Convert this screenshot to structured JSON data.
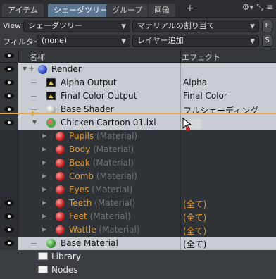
{
  "tabs": [
    {
      "label": "アイテム",
      "active": false
    },
    {
      "label": "シェーダツリー",
      "active": true
    },
    {
      "label": "グループ",
      "active": false
    },
    {
      "label": "画像",
      "active": false
    }
  ],
  "tab_add": "+",
  "top_icons": [
    "gear-icon",
    "expand-icon",
    "menu-icon"
  ],
  "view": {
    "label": "View",
    "dropdown": "シェーダツリー",
    "add_dropdown": "マテリアルの割り当て",
    "button": "F"
  },
  "filter": {
    "label": "フィルター:",
    "dropdown": "(none)",
    "add_dropdown": "レイヤー追加",
    "button": "S"
  },
  "columns": {
    "name": "名称",
    "effect": "エフェクト"
  },
  "tree": [
    {
      "label": "Render",
      "effect": "",
      "icon": "render-ball-icon",
      "expanded": true
    },
    {
      "label": "Alpha Output",
      "effect": "Alpha",
      "icon": "output-icon"
    },
    {
      "label": "Final Color Output",
      "effect": "Final Color",
      "icon": "output-icon"
    },
    {
      "label": "Base Shader",
      "effect": "フルシェーディング",
      "icon": "shader-ball-icon"
    },
    {
      "label": "Chicken Cartoon 01.lxl",
      "effect": "",
      "icon": "material-group-icon",
      "expanded": true
    },
    {
      "label": "Pupils",
      "sub": " (Material)",
      "effect": "",
      "icon": "material-icon"
    },
    {
      "label": "Body",
      "sub": " (Material)",
      "effect": "",
      "icon": "material-icon"
    },
    {
      "label": "Beak",
      "sub": " (Material)",
      "effect": "",
      "icon": "material-icon"
    },
    {
      "label": "Comb",
      "sub": " (Material)",
      "effect": "",
      "icon": "material-icon"
    },
    {
      "label": "Eyes",
      "sub": " (Material)",
      "effect": "",
      "icon": "material-icon"
    },
    {
      "label": "Teeth",
      "sub": " (Material)",
      "effect": "(全て)",
      "icon": "material-icon"
    },
    {
      "label": "Feet",
      "sub": " (Material)",
      "effect": "(全て)",
      "icon": "material-icon"
    },
    {
      "label": "Wattle",
      "sub": " (Material)",
      "effect": "(全て)",
      "icon": "material-icon"
    },
    {
      "label": "Base Material",
      "effect": "(全て)",
      "icon": "base-material-icon"
    },
    {
      "label": "Library",
      "effect": "",
      "icon": "folder-icon"
    },
    {
      "label": "Nodes",
      "effect": "",
      "icon": "folder-icon"
    }
  ],
  "colors": {
    "accent_orange": "#f0a030",
    "tab_active": "#5a7690",
    "material_label": "#e39a32"
  }
}
